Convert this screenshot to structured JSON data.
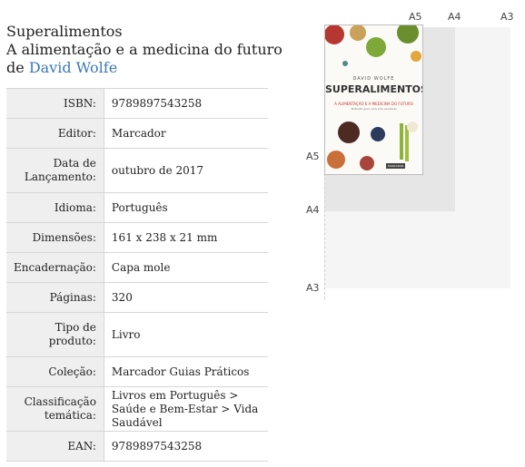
{
  "book": {
    "title": "Superalimentos",
    "subtitle": "A alimentação e a medicina do futuro",
    "author_prefix": "de",
    "author": "David Wolfe"
  },
  "specs": [
    {
      "label": "ISBN:",
      "value": "9789897543258"
    },
    {
      "label": "Editor:",
      "value": "Marcador"
    },
    {
      "label": "Data de Lançamento:",
      "value": "outubro de 2017"
    },
    {
      "label": "Idioma:",
      "value": "Português"
    },
    {
      "label": "Dimensões:",
      "value": "161 x 238 x 21 mm"
    },
    {
      "label": "Encadernação:",
      "value": "Capa mole"
    },
    {
      "label": "Páginas:",
      "value": "320"
    },
    {
      "label": "Tipo de produto:",
      "value": "Livro"
    },
    {
      "label": "Coleção:",
      "value": "Marcador Guias Práticos"
    },
    {
      "label": "Classificação temática:",
      "value": "Livros em Português > Saúde e Bem-Estar > Vida Saudável"
    },
    {
      "label": "EAN:",
      "value": "9789897543258"
    }
  ],
  "size_guide": {
    "top_labels": [
      "A5",
      "A4",
      "A3"
    ],
    "side_labels": [
      "A5",
      "A4",
      "A3"
    ]
  },
  "cover": {
    "author": "DAVID WOLFE",
    "title": "SUPERALIMENTOS",
    "subtitle": "A ALIMENTAÇÃO E A MEDICINA DO FUTURO",
    "tagline": "Nutrição para uma vida saudável",
    "publisher": "MARCADOR"
  }
}
